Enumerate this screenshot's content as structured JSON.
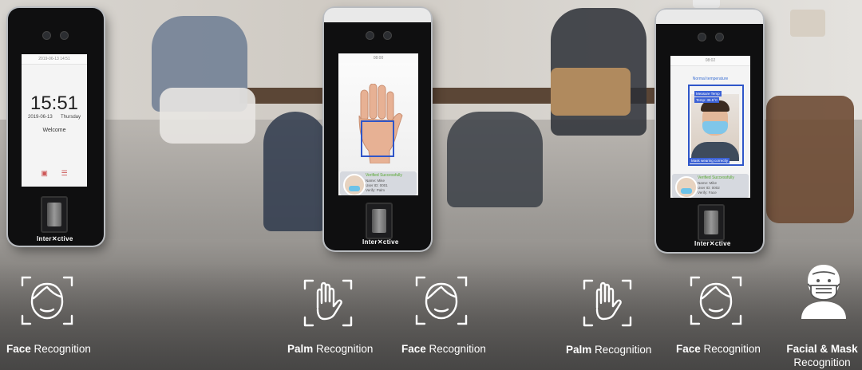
{
  "devices": [
    {
      "brand": "Inter✕ctive",
      "statusbar": "2019-06-13 14:51",
      "clock": "15:51",
      "date": "2019-06-13",
      "weekday": "Thursday",
      "welcome": "Welcome"
    },
    {
      "brand": "Inter✕ctive",
      "statusbar": "08:00",
      "card_success": "Verified Successfully",
      "card_lines": [
        "Name: Mike",
        "User ID: 0001",
        "Verify: Palm"
      ]
    },
    {
      "brand": "Inter✕ctive",
      "statusbar": "08:02",
      "temp_header": "Normal temperature",
      "measure_label": "Measure Temp",
      "temp_value": "Temp: 36.5°C",
      "mask_status": "Mask wearing correctly",
      "card_success": "Verified Successfully",
      "card_lines": [
        "Name: Mike",
        "User ID: 0002",
        "Verify: Face"
      ]
    }
  ],
  "features": [
    {
      "bold": "Face",
      "rest": " Recognition",
      "icon": "face-scan-icon"
    },
    {
      "bold": "Palm",
      "rest": " Recognition",
      "icon": "palm-scan-icon"
    },
    {
      "bold": "Face",
      "rest": " Recognition",
      "icon": "face-scan-icon"
    },
    {
      "bold": "Palm",
      "rest": " Recognition",
      "icon": "palm-scan-icon"
    },
    {
      "bold": "Face",
      "rest": " Recognition",
      "icon": "face-scan-icon"
    },
    {
      "bold": "Facial & Mask",
      "rest": "Recognition",
      "icon": "masked-face-icon"
    }
  ]
}
